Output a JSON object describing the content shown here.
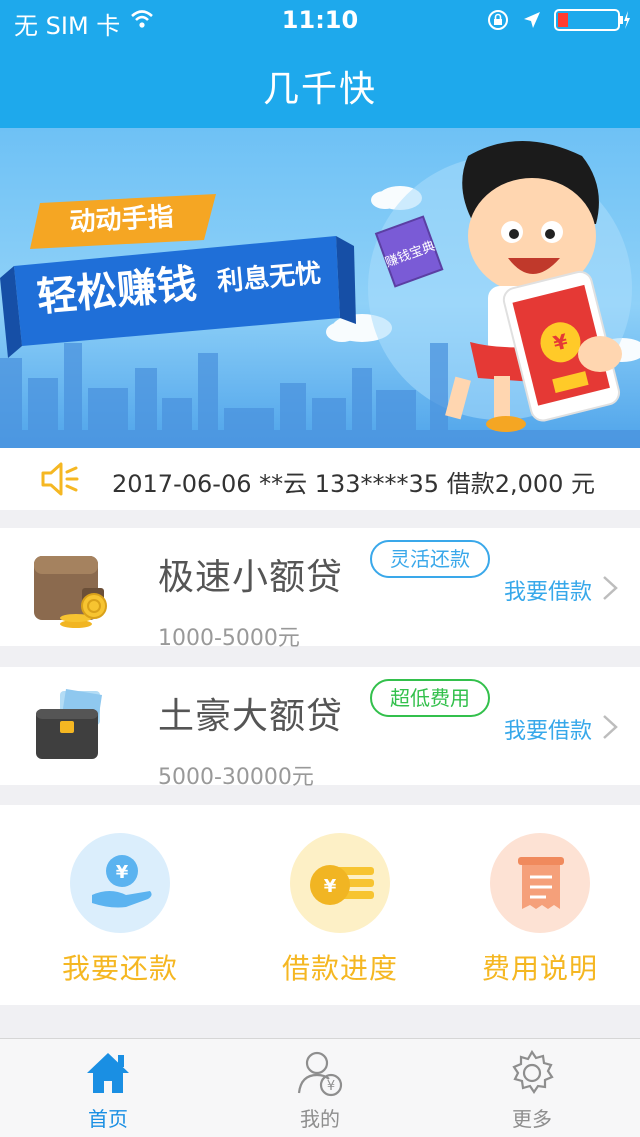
{
  "status_bar": {
    "carrier": "无 SIM 卡",
    "time": "11:10"
  },
  "nav": {
    "title": "几千快"
  },
  "banner": {
    "tag": "动动手指",
    "headline": "轻松赚钱",
    "subheadline": "利息无忧",
    "book_text": "赚钱宝典",
    "currency_symbol": "¥"
  },
  "notice": {
    "text": "2017-06-06 **云 133****35 借款2,000 元"
  },
  "loans": [
    {
      "name": "极速小额贷",
      "tag": "灵活还款",
      "tag_color": "#3aa8ea",
      "range": "1000-5000元",
      "action": "我要借款"
    },
    {
      "name": "土豪大额贷",
      "tag": "超低费用",
      "tag_color": "#33c04c",
      "range": "5000-30000元",
      "action": "我要借款"
    }
  ],
  "quick": [
    {
      "label": "我要还款",
      "icon": "hand-coin-icon",
      "bg": "#dbeefc"
    },
    {
      "label": "借款进度",
      "icon": "coin-stack-icon",
      "bg": "#fdf0c6"
    },
    {
      "label": "费用说明",
      "icon": "receipt-icon",
      "bg": "#fde2d4"
    }
  ],
  "tabs": [
    {
      "label": "首页",
      "icon": "home-icon",
      "active": true
    },
    {
      "label": "我的",
      "icon": "user-coin-icon",
      "active": false
    },
    {
      "label": "更多",
      "icon": "gear-icon",
      "active": false
    }
  ],
  "colors": {
    "primary": "#1ea9ec",
    "accent_yellow": "#f5b722",
    "tab_active": "#1a8fe3",
    "tab_inactive": "#8e8e8e"
  }
}
